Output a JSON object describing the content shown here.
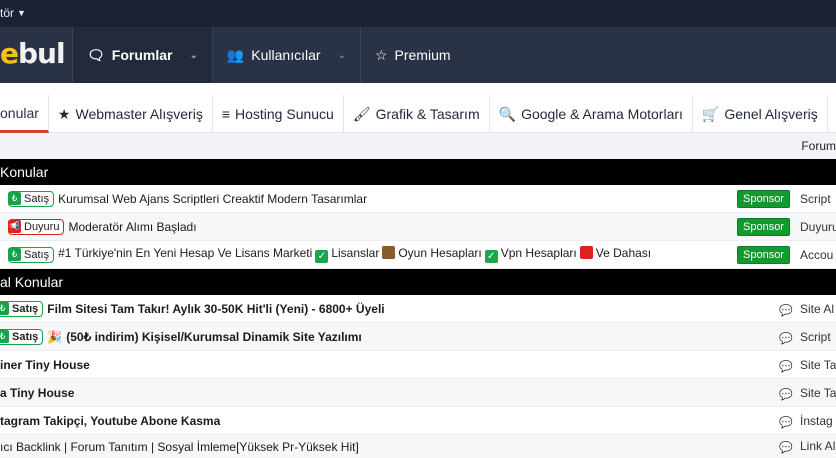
{
  "topbar": {
    "moderator": "tör"
  },
  "header": {
    "logo_prefix": "e",
    "logo_main": "bul",
    "nav": [
      {
        "label": "Forumlar"
      },
      {
        "label": "Kullanıcılar"
      },
      {
        "label": "Premium"
      }
    ]
  },
  "categories": [
    {
      "label": "onular"
    },
    {
      "label": "Webmaster Alışveriş"
    },
    {
      "label": "Hosting Sunucu"
    },
    {
      "label": "Grafik & Tasarım"
    },
    {
      "label": "Google & Arama Motorları"
    },
    {
      "label": "Genel Alışveriş"
    }
  ],
  "subbar": {
    "right": "Forum"
  },
  "section1": {
    "title": "Konular",
    "rows": [
      {
        "tag": "Satış",
        "title": "Kurumsal Web Ajans Scriptleri Creaktif Modern Tasarımlar",
        "badge": "Sponsor",
        "right": "Script"
      },
      {
        "tag": "Duyuru",
        "title": "Moderatör Alımı Başladı",
        "badge": "Sponsor",
        "right": "Duyuru"
      },
      {
        "tag": "Satış",
        "title_a": "#1 Türkiye'nin En Yeni Hesap Ve Lisans Marketi",
        "t1": "Lisanslar",
        "t2": "Oyun Hesapları",
        "t3": "Vpn Hesapları",
        "t4": "Ve Dahası",
        "badge": "Sponsor",
        "right": "Accou"
      }
    ]
  },
  "section2": {
    "title": "al Konular",
    "rows": [
      {
        "tag": "Satış",
        "title": "Film Sitesi Tam Takır! Aylık 30-50K Hit'li (Yeni) - 6800+ Üyeli",
        "right": "Site Al"
      },
      {
        "tag": "Satış",
        "title": "(50₺ indirim) Kişisel/Kurumsal Dinamik Site Yazılımı",
        "right": "Script"
      },
      {
        "title": "iner Tiny House",
        "right": "Site Ta"
      },
      {
        "title": "a Tiny House",
        "right": "Site Ta"
      },
      {
        "title": "tagram Takipçi, Youtube Abone Kasma",
        "right": "İnstag"
      },
      {
        "title": "ıcı Backlink | Forum Tanıtım | Sosyal İmleme[Yüksek Pr-Yüksek Hit]",
        "right": "Link Al"
      }
    ]
  },
  "colors": {
    "accent": "#d4402b",
    "header_bg": "#2a3245",
    "sponsor": "#139a2e"
  }
}
